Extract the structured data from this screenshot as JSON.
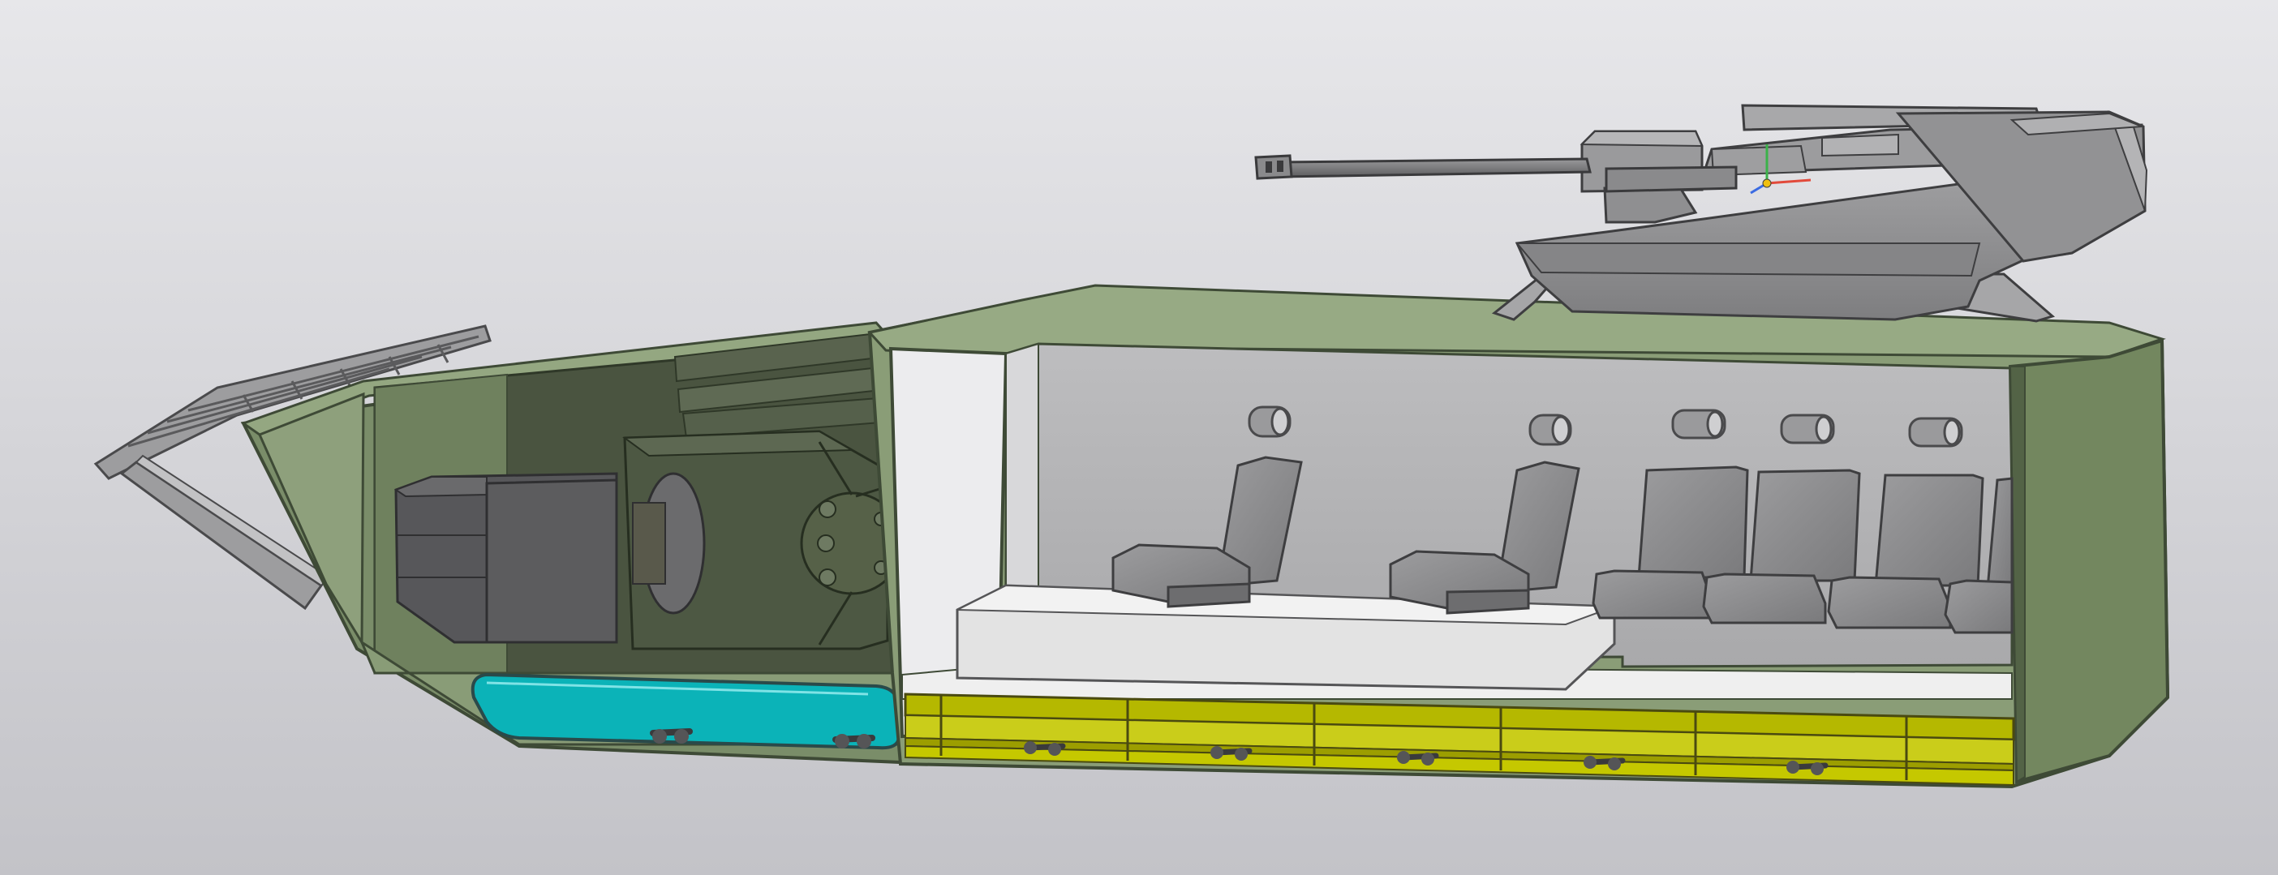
{
  "viewport": {
    "background_top": "#e7e7ea",
    "background_bottom": "#c3c3c8"
  },
  "model": {
    "colors": {
      "hull_green": "#889c74",
      "hull_green_dark": "#6e8160",
      "hull_edge": "#3e4a36",
      "engine_block": "#4a5440",
      "turret_gray": "#8a8a8c",
      "seat_gray": "#8d8d8f",
      "interior_wall": "#b4b4b6",
      "floor_light": "#ececec",
      "fuel_tank_cyan": "#0bb3b8",
      "floor_grating_yellow": "#b5b800"
    },
    "parts": [
      "bow-ramp",
      "engine-compartment",
      "troop-compartment",
      "turret",
      "cannon",
      "seats",
      "fuel-tank",
      "floor-grating"
    ]
  },
  "axis_triad": {
    "x_color": "#e24a3b",
    "y_color": "#3bb24a",
    "z_color": "#3b6be2"
  }
}
